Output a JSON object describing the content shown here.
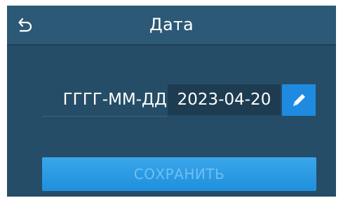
{
  "header": {
    "title": "Дата",
    "back_icon": "undo-arrow-icon"
  },
  "date_field": {
    "format_label": "ГГГГ-ММ-ДД",
    "value": "2023-04-20",
    "edit_icon": "pencil-icon"
  },
  "actions": {
    "save_label": "СОХРАНИТЬ",
    "save_enabled": false
  },
  "colors": {
    "background": "#254d67",
    "header": "#2b5976",
    "field": "#1e3c51",
    "accent": "#1e8be0",
    "text": "#ffffff"
  }
}
